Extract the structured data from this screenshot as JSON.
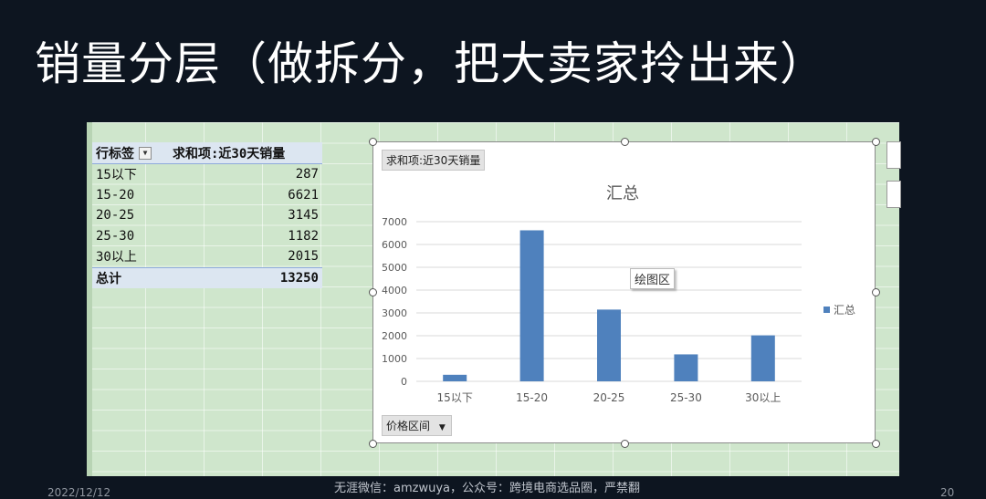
{
  "slide": {
    "title": "销量分层（做拆分，把大卖家拎出来）",
    "footer": "无涯微信：amzwuya，公众号：跨境电商选品圈，严禁翻",
    "date": "2022/12/12",
    "page": "20"
  },
  "pivot": {
    "row_header": "行标签",
    "value_header": "求和项:近30天销量",
    "filter_glyph": "▼",
    "rows": [
      {
        "label": "15以下",
        "value": "287"
      },
      {
        "label": "15-20",
        "value": "6621"
      },
      {
        "label": "20-25",
        "value": "3145"
      },
      {
        "label": "25-30",
        "value": "1182"
      },
      {
        "label": "30以上",
        "value": "2015"
      }
    ],
    "total_label": "总计",
    "total_value": "13250"
  },
  "chart": {
    "value_field_button": "求和项:近30天销量",
    "axis_field_button": "价格区间",
    "axis_field_glyph": "▼",
    "plot_area_tooltip": "绘图区",
    "bar_color": "#4f81bd"
  },
  "chart_data": {
    "type": "bar",
    "title": "汇总",
    "categories": [
      "15以下",
      "15-20",
      "20-25",
      "25-30",
      "30以上"
    ],
    "series": [
      {
        "name": "汇总",
        "values": [
          287,
          6621,
          3145,
          1182,
          2015
        ]
      }
    ],
    "xlabel": "",
    "ylabel": "",
    "ylim": [
      0,
      7000
    ],
    "yticks": [
      0,
      1000,
      2000,
      3000,
      4000,
      5000,
      6000,
      7000
    ],
    "grid": true,
    "legend": "right"
  }
}
